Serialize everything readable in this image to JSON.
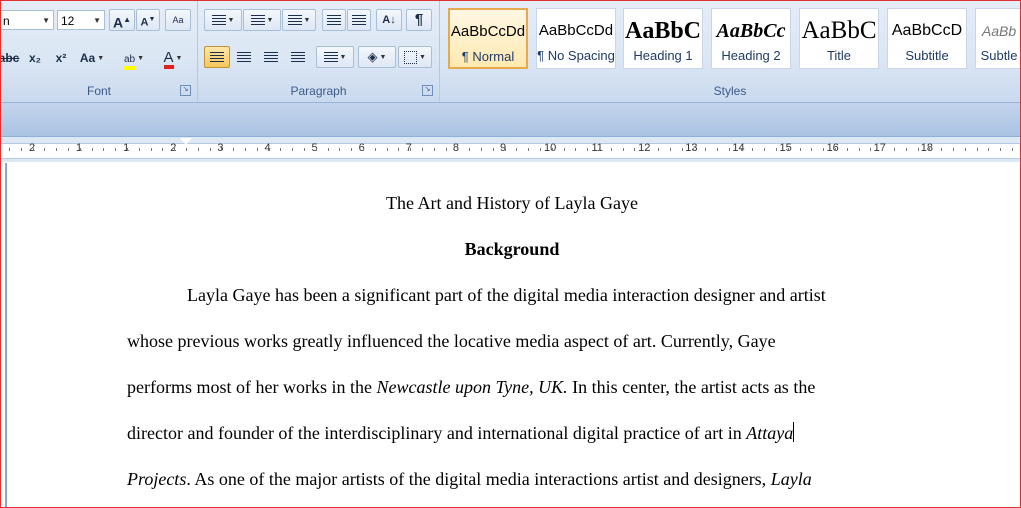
{
  "font": {
    "name": "n",
    "size": "12"
  },
  "buttons": {
    "grow": "A",
    "shrink": "A",
    "clear": "Aa",
    "strike": "abc",
    "subscript": "x₂",
    "superscript": "x²",
    "change_case": "Aa",
    "highlight": "ab",
    "font_color": "A",
    "pilcrow": "¶"
  },
  "groups": {
    "font": "Font",
    "paragraph": "Paragraph",
    "styles": "Styles"
  },
  "styles": [
    {
      "sample": "AaBbCcDd",
      "name": "¶ Normal"
    },
    {
      "sample": "AaBbCcDd",
      "name": "¶ No Spacing"
    },
    {
      "sample": "AaBbC",
      "name": "Heading 1"
    },
    {
      "sample": "AaBbCc",
      "name": "Heading 2"
    },
    {
      "sample": "AaBbC",
      "name": "Title"
    },
    {
      "sample": "AaBbCcD",
      "name": "Subtitle"
    },
    {
      "sample": "AaBb",
      "name": "Subtle"
    }
  ],
  "ruler": {
    "numbers": [
      "2",
      "1",
      "1",
      "2",
      "3",
      "4",
      "5",
      "6",
      "7",
      "8",
      "9",
      "10",
      "11",
      "12",
      "13",
      "14",
      "15",
      "16",
      "17",
      "18"
    ]
  },
  "colors": {
    "highlight": "#ffff00",
    "font_color": "#e02020",
    "accent": "#f8c65a"
  },
  "document": {
    "title": "The Art and History of Layla Gaye",
    "heading": "Background",
    "p1": "Layla Gaye has been a significant part of the digital media interaction designer and artist",
    "p2": "whose previous works greatly influenced the locative media aspect of art. Currently, Gaye",
    "p3_a": "performs most of her works in the ",
    "p3_italic": "Newcastle upon Tyne, UK.",
    "p3_b": " In this center, the artist acts as the",
    "p4_a": "director and founder of the interdisciplinary and international digital practice of art in ",
    "p4_italic": "Attaya",
    "p5_italic": "Projects",
    "p5_a": ". As one of the major artists of the digital media interactions artist and designers, ",
    "p5_italic2": "Layla"
  }
}
